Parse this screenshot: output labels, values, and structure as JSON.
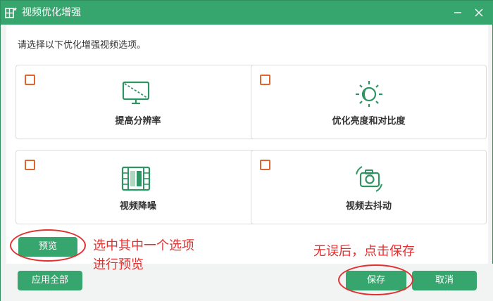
{
  "window": {
    "title": "视频优化增强"
  },
  "content": {
    "instruction": "请选择以下优化增强视频选项。",
    "options": [
      {
        "label": "提高分辨率",
        "icon": "monitor-resolution-icon",
        "checked": false
      },
      {
        "label": "优化亮度和对比度",
        "icon": "brightness-icon",
        "checked": false
      },
      {
        "label": "视频降噪",
        "icon": "film-denoise-icon",
        "checked": false
      },
      {
        "label": "视频去抖动",
        "icon": "camera-stabilize-icon",
        "checked": false
      }
    ],
    "preview_label": "预览"
  },
  "footer": {
    "apply_all_label": "应用全部",
    "save_label": "保存",
    "cancel_label": "取消"
  },
  "annotations": {
    "preview_line1": "选中其中一个选项",
    "preview_line2": "进行预览",
    "save_note": "无误后，点击保存"
  },
  "colors": {
    "accent": "#37a66e",
    "checkbox": "#e0652c",
    "annotation": "#e33131",
    "icon": "#2f9463"
  }
}
